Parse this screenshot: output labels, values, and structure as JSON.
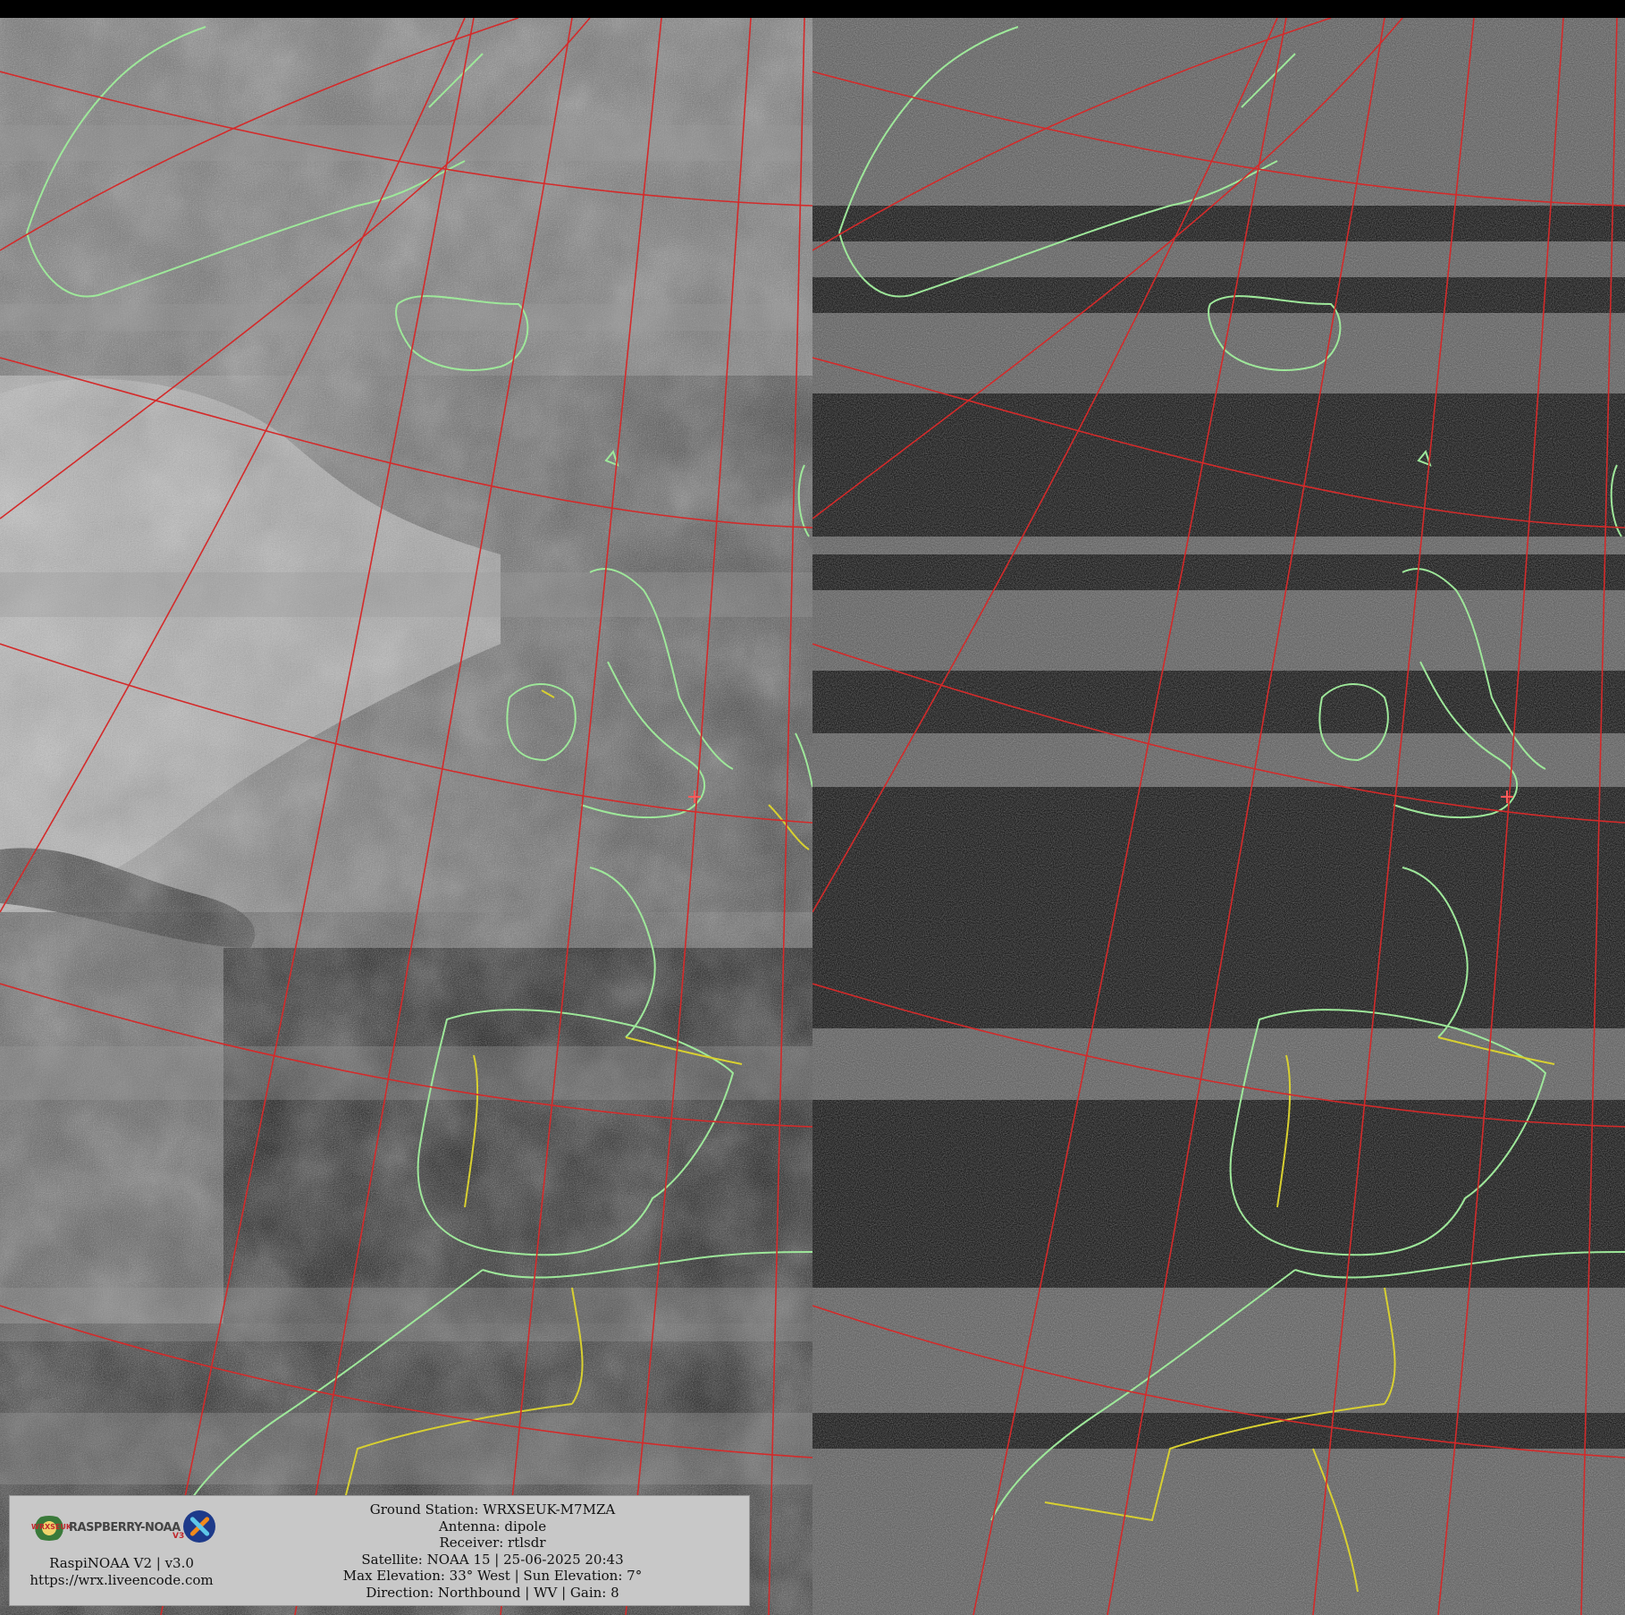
{
  "image": {
    "description_type": "dual-channel APT weather satellite image with map overlay",
    "panels": [
      {
        "name": "left-channel",
        "tone": "visible-grayscale"
      },
      {
        "name": "right-channel",
        "tone": "dark-infrared"
      }
    ],
    "colors": {
      "grid_lines": "#d42a2a",
      "coastlines": "#9ee89a",
      "borders": "#d8d030",
      "infobox_bg": "#c8c8c8"
    }
  },
  "logo": {
    "brand_small": "WRXSEUK",
    "brand_main": "RASPBERRY-NOAA",
    "version_mark": "V3"
  },
  "info_left": {
    "app_version": "RaspiNOAA V2 | v3.0",
    "url": "https://wrx.liveencode.com"
  },
  "info_right": {
    "ground_station": "Ground Station: WRXSEUK-M7MZA",
    "antenna": "Antenna: dipole",
    "receiver": "Receiver: rtlsdr",
    "satellite": "Satellite: NOAA 15 | 25-06-2025 20:43",
    "elevation": "Max Elevation: 33° West | Sun Elevation: 7°",
    "direction": "Direction: Northbound | WV | Gain: 8"
  }
}
